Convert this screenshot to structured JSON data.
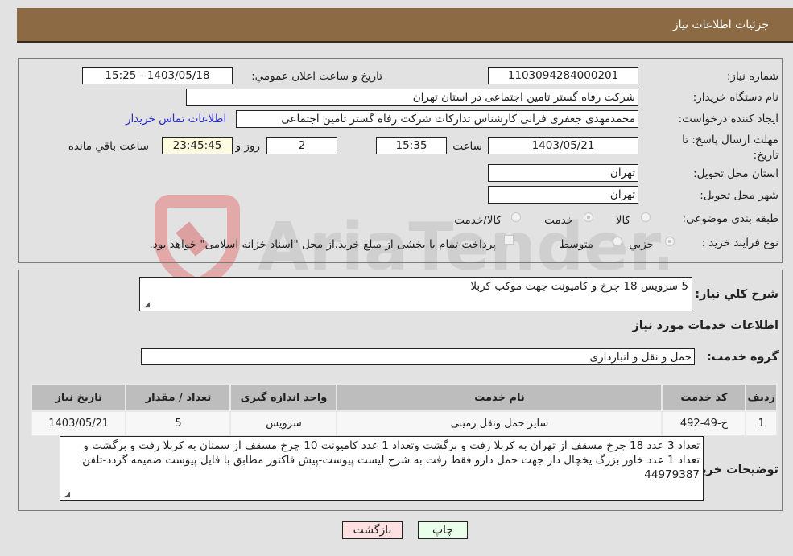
{
  "header": {
    "title": "جزئيات اطلاعات نياز"
  },
  "fields": {
    "need_number_label": "شماره نیاز:",
    "need_number": "1103094284000201",
    "announce_label": "تاريخ و ساعت اعلان عمومي:",
    "announce_value": "1403/05/18 - 15:25",
    "buyer_org_label": "نام دستگاه خریدار:",
    "buyer_org": "شرکت رفاه گستر تامین اجتماعی در استان تهران",
    "creator_label": "ایجاد کننده درخواست:",
    "creator": "محمدمهدی جعفری فرانی کارشناس تدارکات شرکت رفاه گستر تامین اجتماعی",
    "contact_link": "اطلاعات تماس خریدار",
    "deadline_label": "مهلت ارسال پاسخ: تا تاریخ:",
    "deadline_date": "1403/05/21",
    "time_label": "ساعت",
    "deadline_time": "15:35",
    "days_value": "2",
    "days_label": "روز و",
    "remaining_time": "23:45:45",
    "remaining_label": "ساعت باقي مانده",
    "province_label": "استان محل تحویل:",
    "province": "تهران",
    "city_label": "شهر محل تحویل:",
    "city": "تهران",
    "category_label": "طبقه بندی موضوعی:",
    "category_options": [
      "کالا",
      "خدمت",
      "کالا/خدمت"
    ],
    "category_selected": "خدمت",
    "process_label": "نوع فرآیند خرید :",
    "process_options": [
      "جزيي",
      "متوسط"
    ],
    "process_selected": "جزيي",
    "treasury_note": "پرداخت تمام یا بخشی از مبلغ خرید،از محل \"اسناد خزانه اسلامی\" خواهد بود."
  },
  "details": {
    "summary_label": "شرح كلي نياز:",
    "summary": "5 سرویس 18 چرخ و کامیونت جهت موکب کربلا",
    "services_heading": "اطلاعات خدمات مورد نیاز",
    "service_group_label": "گروه خدمت:",
    "service_group": "حمل و نقل و انبارداری",
    "table": {
      "headers": [
        "ردیف",
        "کد خدمت",
        "نام خدمت",
        "واحد اندازه گیری",
        "تعداد / مقدار",
        "تاریخ نیاز"
      ],
      "rows": [
        [
          "1",
          "ح-49-492",
          "سایر حمل ونقل زمینی",
          "سرویس",
          "5",
          "1403/05/21"
        ]
      ]
    },
    "buyer_notes_label": "توضیحات خریدار:",
    "buyer_notes": "تعداد 3 عدد 18 چرخ مسقف از تهران به کربلا رفت و برگشت وتعداد 1 عدد کامیونت 10 چرخ مسقف از سمنان به کربلا رفت و برگشت و تعداد 1 عدد خاور بزرگ یخچال دار جهت حمل دارو فقط رفت به شرح لیست پیوست-پیش فاکتور مطابق با فایل پیوست ضمیمه گردد-تلفن 44979387"
  },
  "buttons": {
    "back": "بازگشت",
    "print": "چاپ"
  },
  "watermark": "AriaTender.neT"
}
